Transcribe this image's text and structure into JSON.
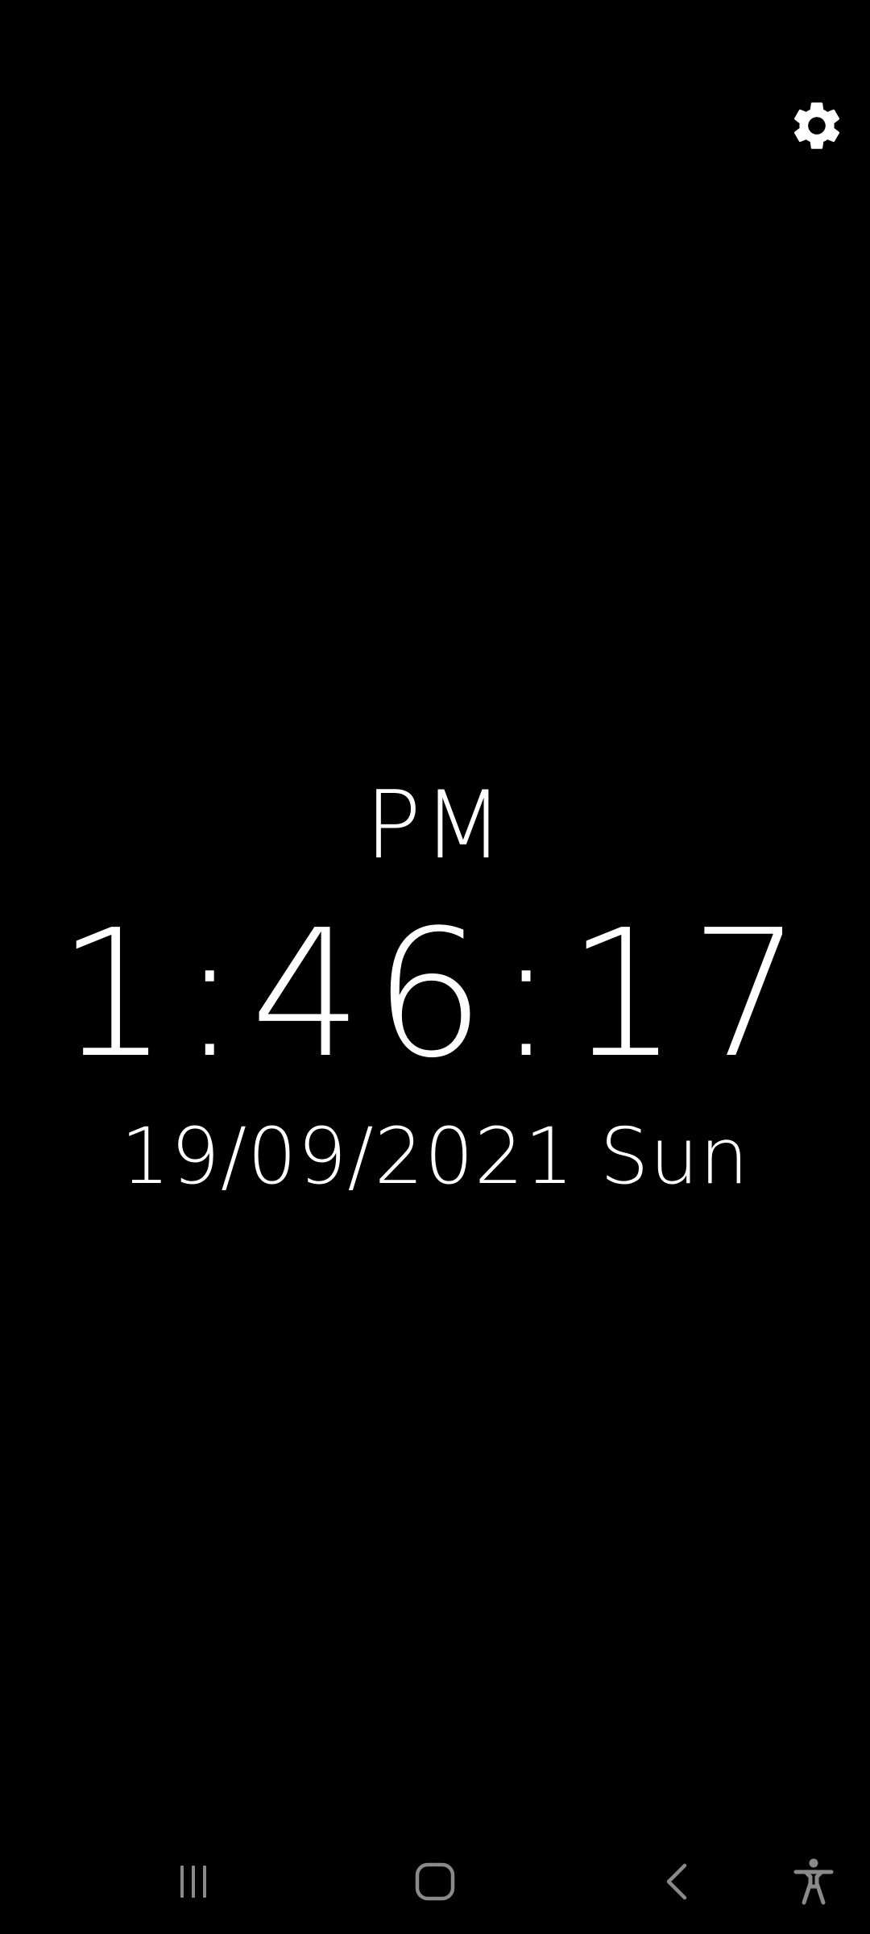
{
  "clock": {
    "ampm": "PM",
    "time": "1:46:17",
    "date": "19/09/2021 Sun"
  },
  "toolbar": {
    "settings_icon": "gear-icon"
  },
  "navigation_bar": {
    "recent_apps_icon": "recent-apps-icon",
    "home_icon": "home-icon",
    "back_icon": "back-icon",
    "accessibility_icon": "accessibility-icon"
  },
  "colors": {
    "background": "#000000",
    "text": "#ffffff",
    "nav_icons": "#8a8a8a"
  }
}
